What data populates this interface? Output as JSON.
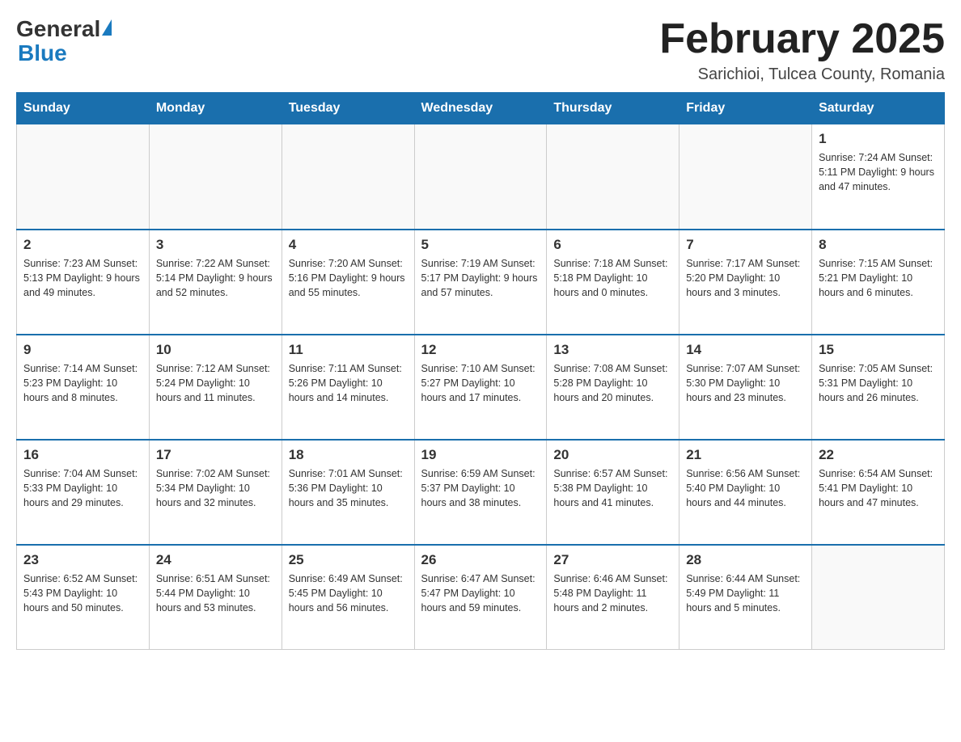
{
  "header": {
    "logo_general": "General",
    "logo_blue": "Blue",
    "month_title": "February 2025",
    "location": "Sarichioi, Tulcea County, Romania"
  },
  "columns": [
    "Sunday",
    "Monday",
    "Tuesday",
    "Wednesday",
    "Thursday",
    "Friday",
    "Saturday"
  ],
  "weeks": [
    [
      {
        "day": "",
        "info": ""
      },
      {
        "day": "",
        "info": ""
      },
      {
        "day": "",
        "info": ""
      },
      {
        "day": "",
        "info": ""
      },
      {
        "day": "",
        "info": ""
      },
      {
        "day": "",
        "info": ""
      },
      {
        "day": "1",
        "info": "Sunrise: 7:24 AM\nSunset: 5:11 PM\nDaylight: 9 hours and 47 minutes."
      }
    ],
    [
      {
        "day": "2",
        "info": "Sunrise: 7:23 AM\nSunset: 5:13 PM\nDaylight: 9 hours and 49 minutes."
      },
      {
        "day": "3",
        "info": "Sunrise: 7:22 AM\nSunset: 5:14 PM\nDaylight: 9 hours and 52 minutes."
      },
      {
        "day": "4",
        "info": "Sunrise: 7:20 AM\nSunset: 5:16 PM\nDaylight: 9 hours and 55 minutes."
      },
      {
        "day": "5",
        "info": "Sunrise: 7:19 AM\nSunset: 5:17 PM\nDaylight: 9 hours and 57 minutes."
      },
      {
        "day": "6",
        "info": "Sunrise: 7:18 AM\nSunset: 5:18 PM\nDaylight: 10 hours and 0 minutes."
      },
      {
        "day": "7",
        "info": "Sunrise: 7:17 AM\nSunset: 5:20 PM\nDaylight: 10 hours and 3 minutes."
      },
      {
        "day": "8",
        "info": "Sunrise: 7:15 AM\nSunset: 5:21 PM\nDaylight: 10 hours and 6 minutes."
      }
    ],
    [
      {
        "day": "9",
        "info": "Sunrise: 7:14 AM\nSunset: 5:23 PM\nDaylight: 10 hours and 8 minutes."
      },
      {
        "day": "10",
        "info": "Sunrise: 7:12 AM\nSunset: 5:24 PM\nDaylight: 10 hours and 11 minutes."
      },
      {
        "day": "11",
        "info": "Sunrise: 7:11 AM\nSunset: 5:26 PM\nDaylight: 10 hours and 14 minutes."
      },
      {
        "day": "12",
        "info": "Sunrise: 7:10 AM\nSunset: 5:27 PM\nDaylight: 10 hours and 17 minutes."
      },
      {
        "day": "13",
        "info": "Sunrise: 7:08 AM\nSunset: 5:28 PM\nDaylight: 10 hours and 20 minutes."
      },
      {
        "day": "14",
        "info": "Sunrise: 7:07 AM\nSunset: 5:30 PM\nDaylight: 10 hours and 23 minutes."
      },
      {
        "day": "15",
        "info": "Sunrise: 7:05 AM\nSunset: 5:31 PM\nDaylight: 10 hours and 26 minutes."
      }
    ],
    [
      {
        "day": "16",
        "info": "Sunrise: 7:04 AM\nSunset: 5:33 PM\nDaylight: 10 hours and 29 minutes."
      },
      {
        "day": "17",
        "info": "Sunrise: 7:02 AM\nSunset: 5:34 PM\nDaylight: 10 hours and 32 minutes."
      },
      {
        "day": "18",
        "info": "Sunrise: 7:01 AM\nSunset: 5:36 PM\nDaylight: 10 hours and 35 minutes."
      },
      {
        "day": "19",
        "info": "Sunrise: 6:59 AM\nSunset: 5:37 PM\nDaylight: 10 hours and 38 minutes."
      },
      {
        "day": "20",
        "info": "Sunrise: 6:57 AM\nSunset: 5:38 PM\nDaylight: 10 hours and 41 minutes."
      },
      {
        "day": "21",
        "info": "Sunrise: 6:56 AM\nSunset: 5:40 PM\nDaylight: 10 hours and 44 minutes."
      },
      {
        "day": "22",
        "info": "Sunrise: 6:54 AM\nSunset: 5:41 PM\nDaylight: 10 hours and 47 minutes."
      }
    ],
    [
      {
        "day": "23",
        "info": "Sunrise: 6:52 AM\nSunset: 5:43 PM\nDaylight: 10 hours and 50 minutes."
      },
      {
        "day": "24",
        "info": "Sunrise: 6:51 AM\nSunset: 5:44 PM\nDaylight: 10 hours and 53 minutes."
      },
      {
        "day": "25",
        "info": "Sunrise: 6:49 AM\nSunset: 5:45 PM\nDaylight: 10 hours and 56 minutes."
      },
      {
        "day": "26",
        "info": "Sunrise: 6:47 AM\nSunset: 5:47 PM\nDaylight: 10 hours and 59 minutes."
      },
      {
        "day": "27",
        "info": "Sunrise: 6:46 AM\nSunset: 5:48 PM\nDaylight: 11 hours and 2 minutes."
      },
      {
        "day": "28",
        "info": "Sunrise: 6:44 AM\nSunset: 5:49 PM\nDaylight: 11 hours and 5 minutes."
      },
      {
        "day": "",
        "info": ""
      }
    ]
  ]
}
